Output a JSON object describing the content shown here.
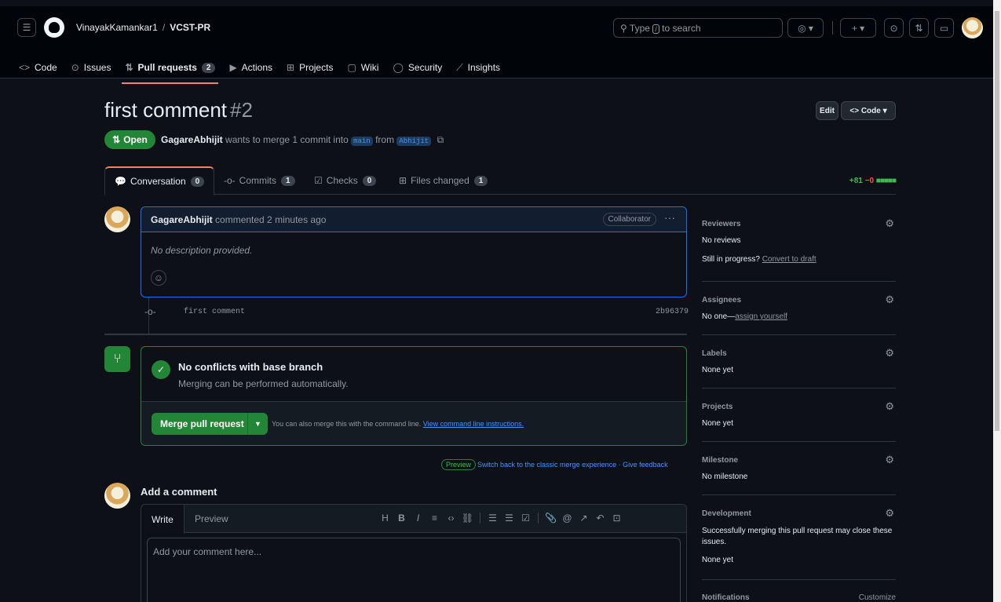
{
  "header": {
    "owner": "VinayakKamankar1",
    "separator": "/",
    "repo": "VCST-PR",
    "search_prefix": "Type",
    "search_key": "/",
    "search_suffix": "to search",
    "plus_label": "+ ▾",
    "copilot_label": "◎ ▾"
  },
  "repo_tabs": [
    {
      "icon": "<>",
      "label": "Code"
    },
    {
      "icon": "⊙",
      "label": "Issues"
    },
    {
      "icon": "⇅",
      "label": "Pull requests",
      "count": "2"
    },
    {
      "icon": "▶",
      "label": "Actions"
    },
    {
      "icon": "⊞",
      "label": "Projects"
    },
    {
      "icon": "▢",
      "label": "Wiki"
    },
    {
      "icon": "◯",
      "label": "Security"
    },
    {
      "icon": "⟋",
      "label": "Insights"
    }
  ],
  "pr": {
    "title": "first comment",
    "number": "#2",
    "edit_label": "Edit",
    "code_label": "<> Code ▾",
    "status": "Open",
    "author": "GagareAbhijit",
    "merge_text": "wants to merge 1 commit into",
    "base_branch": "main",
    "from_text": "from",
    "head_branch": "Abhijit"
  },
  "pr_tabs": [
    {
      "label": "Conversation",
      "count": "0"
    },
    {
      "label": "Commits",
      "count": "1"
    },
    {
      "label": "Checks",
      "count": "0"
    },
    {
      "label": "Files changed",
      "count": "1"
    }
  ],
  "diffstat": {
    "additions": "+81",
    "deletions": "−0",
    "blocks": "■■■■■"
  },
  "comment": {
    "author": "GagareAbhijit",
    "meta": "commented 2 minutes ago",
    "role": "Collaborator",
    "body": "No description provided."
  },
  "commit": {
    "message": "first comment",
    "sha": "2b96379"
  },
  "merge": {
    "title": "No conflicts with base branch",
    "subtitle": "Merging can be performed automatically.",
    "button": "Merge pull request",
    "note": "You can also merge this with the command line.",
    "note_link": "View command line instructions."
  },
  "preview": {
    "pill": "Preview",
    "switch_text": "Switch back to the classic merge experience",
    "dot": "·",
    "feedback": "Give feedback"
  },
  "add_comment": {
    "title": "Add a comment",
    "write_tab": "Write",
    "preview_tab": "Preview",
    "placeholder": "Add your comment here..."
  },
  "sidebar": {
    "reviewers": {
      "title": "Reviewers",
      "value": "No reviews",
      "progress": "Still in progress?",
      "draft_link": "Convert to draft"
    },
    "assignees": {
      "title": "Assignees",
      "value": "No one—",
      "link": "assign yourself"
    },
    "labels": {
      "title": "Labels",
      "value": "None yet"
    },
    "projects": {
      "title": "Projects",
      "value": "None yet"
    },
    "milestone": {
      "title": "Milestone",
      "value": "No milestone"
    },
    "development": {
      "title": "Development",
      "desc": "Successfully merging this pull request may close these issues.",
      "value": "None yet"
    },
    "notifications": {
      "title": "Notifications",
      "customize": "Customize"
    }
  }
}
